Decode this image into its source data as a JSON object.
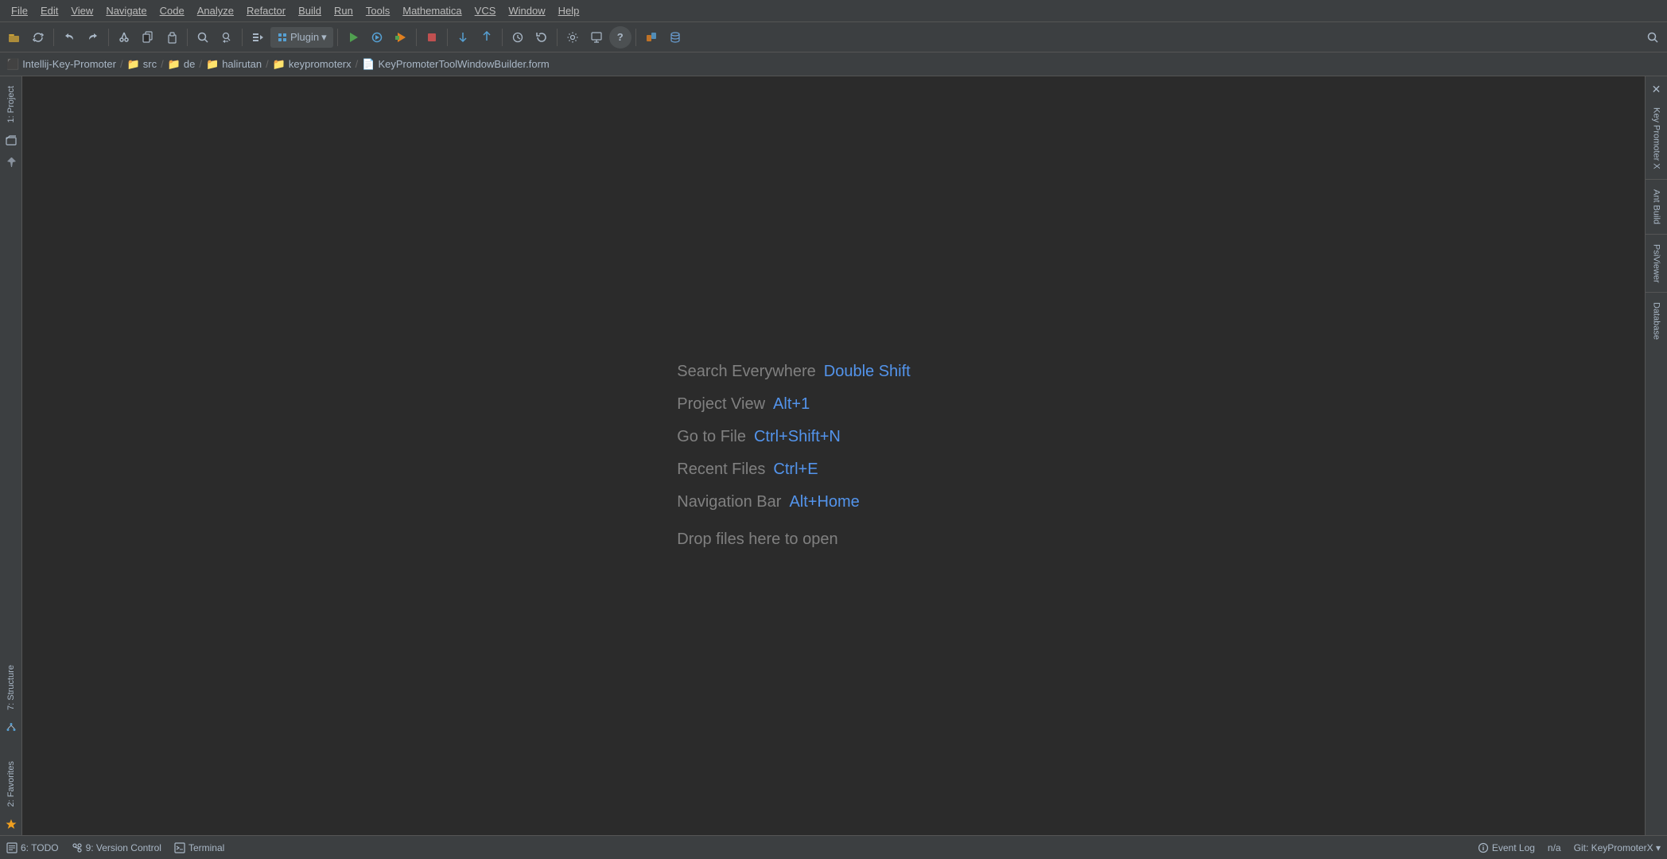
{
  "menubar": {
    "items": [
      {
        "label": "File",
        "name": "menu-file"
      },
      {
        "label": "Edit",
        "name": "menu-edit"
      },
      {
        "label": "View",
        "name": "menu-view"
      },
      {
        "label": "Navigate",
        "name": "menu-navigate"
      },
      {
        "label": "Code",
        "name": "menu-code"
      },
      {
        "label": "Analyze",
        "name": "menu-analyze"
      },
      {
        "label": "Refactor",
        "name": "menu-refactor"
      },
      {
        "label": "Build",
        "name": "menu-build"
      },
      {
        "label": "Run",
        "name": "menu-run"
      },
      {
        "label": "Tools",
        "name": "menu-tools"
      },
      {
        "label": "Mathematica",
        "name": "menu-mathematica"
      },
      {
        "label": "VCS",
        "name": "menu-vcs"
      },
      {
        "label": "Window",
        "name": "menu-window"
      },
      {
        "label": "Help",
        "name": "menu-help"
      }
    ]
  },
  "toolbar": {
    "plugin_label": "Plugin",
    "plugin_dropdown": "▾"
  },
  "breadcrumb": {
    "items": [
      {
        "label": "Intellij-Key-Promoter",
        "type": "project"
      },
      {
        "label": "src",
        "type": "folder"
      },
      {
        "label": "de",
        "type": "folder"
      },
      {
        "label": "halirutan",
        "type": "folder"
      },
      {
        "label": "keypromoterx",
        "type": "folder"
      },
      {
        "label": "KeyPromoterToolWindowBuilder.form",
        "type": "file"
      }
    ]
  },
  "left_sidebar": {
    "tabs": [
      {
        "label": "1: Project",
        "name": "tab-project"
      },
      {
        "label": "7: Structure",
        "name": "tab-structure"
      },
      {
        "label": "2: Favorites",
        "name": "tab-favorites"
      }
    ]
  },
  "right_sidebar": {
    "tabs": [
      {
        "label": "Key Promoter X",
        "name": "tab-key-promoter"
      },
      {
        "label": "Ant Build",
        "name": "tab-ant-build"
      },
      {
        "label": "PsiViewer",
        "name": "tab-psi-viewer"
      },
      {
        "label": "Database",
        "name": "tab-database"
      }
    ]
  },
  "editor": {
    "shortcuts": [
      {
        "label": "Search Everywhere",
        "key": "Double Shift"
      },
      {
        "label": "Project View",
        "key": "Alt+1"
      },
      {
        "label": "Go to File",
        "key": "Ctrl+Shift+N"
      },
      {
        "label": "Recent Files",
        "key": "Ctrl+E"
      },
      {
        "label": "Navigation Bar",
        "key": "Alt+Home"
      }
    ],
    "drop_hint": "Drop files here to open"
  },
  "statusbar": {
    "todo_label": "6: TODO",
    "vcs_label": "9: Version Control",
    "terminal_label": "Terminal",
    "event_log_label": "Event Log",
    "position": "n/a",
    "git_label": "Git: KeyPromoterX ▾"
  }
}
